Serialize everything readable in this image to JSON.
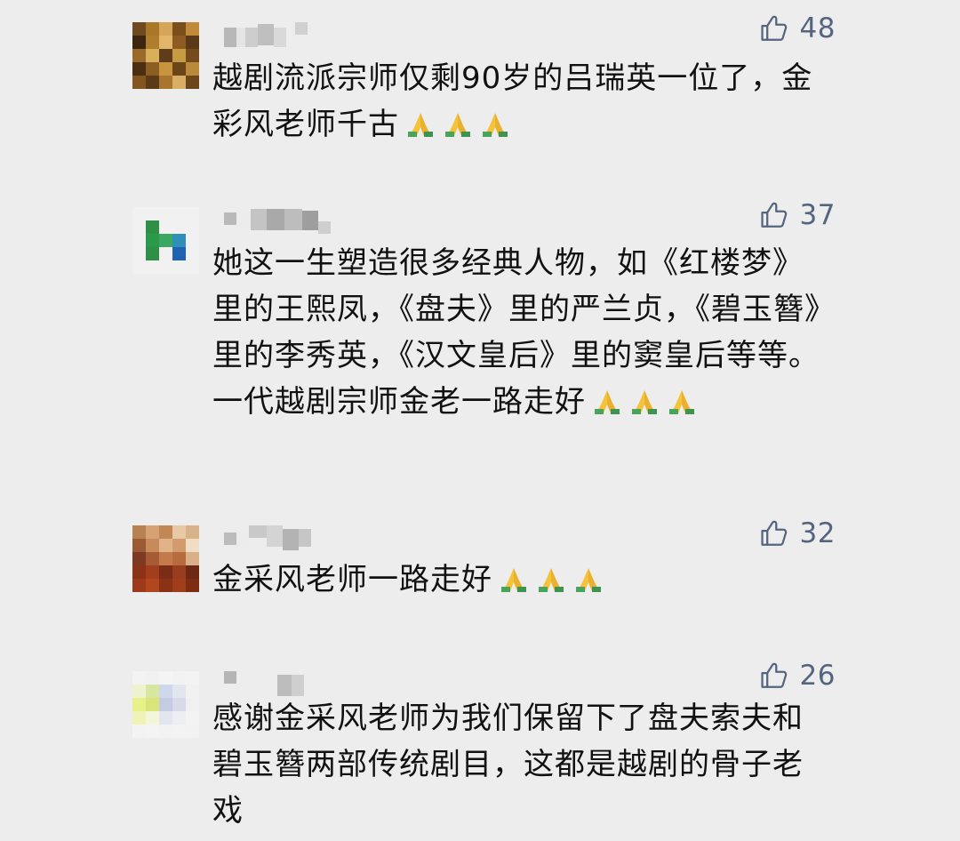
{
  "colors": {
    "background": "#ededed",
    "text": "#111111",
    "like": "#55657f"
  },
  "comments": [
    {
      "likes": "48",
      "text": "越剧流派宗师仅剩90岁的吕瑞英一位了，金彩风老师千古",
      "emoji": "folded-hands",
      "emoji_count": 3
    },
    {
      "likes": "37",
      "text": "她这一生塑造很多经典人物，如《红楼梦》里的王熙凤，《盘夫》里的严兰贞，《碧玉簪》里的李秀英，《汉文皇后》里的窦皇后等等。一代越剧宗师金老一路走好",
      "emoji": "folded-hands",
      "emoji_count": 3
    },
    {
      "likes": "32",
      "text": "金采风老师一路走好",
      "emoji": "folded-hands",
      "emoji_count": 3
    },
    {
      "likes": "26",
      "text": "感谢金采风老师为我们保留下了盘夫索夫和碧玉簪两部传统剧目，这都是越剧的骨子老戏"
    }
  ],
  "icons": {
    "like": "thumbs-up-icon",
    "emoji": "folded-hands-icon"
  }
}
